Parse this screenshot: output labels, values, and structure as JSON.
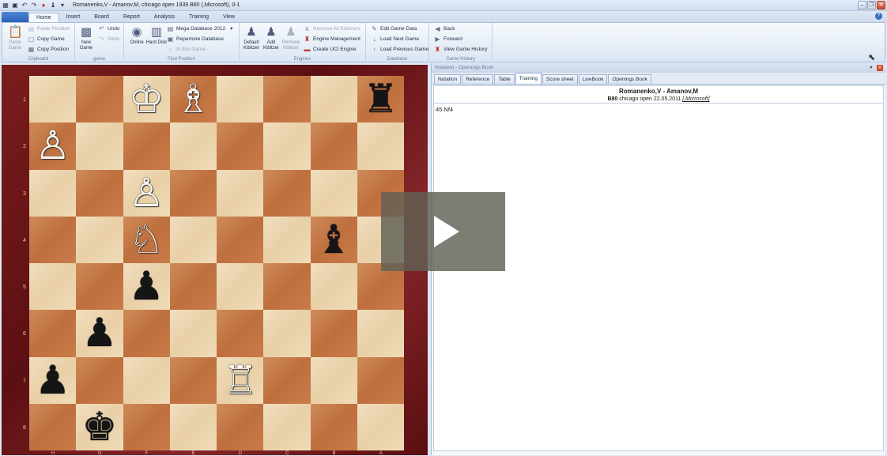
{
  "window": {
    "title": "Romanenko,V - Amanov,M, chicago open 1939  B80  (,Microsoft), 0-1"
  },
  "ribbon_tabs": {
    "file": "",
    "home": "Home",
    "insert": "Insert",
    "board": "Board",
    "report": "Report",
    "analysis": "Analysis",
    "training": "Training",
    "view": "View"
  },
  "clipboard": {
    "paste_game": "Paste Game",
    "paste_position": "Paste Position",
    "copy_game": "Copy Game",
    "copy_position": "Copy Position",
    "label": "Clipboard"
  },
  "game_group": {
    "new_game": "New Game",
    "undo": "Undo",
    "redo": "Redo",
    "label": "game"
  },
  "find_position": {
    "online": "Online",
    "hard_disk": "Hard Disk",
    "database_select": "Mega Database 2012",
    "repertoire": "Repertoire Database",
    "in_this_game": "In this Game",
    "label": "Find Position"
  },
  "engines": {
    "default_kibitzer": "Default Kibitzer",
    "add_kibitzer": "Add Kibitzer",
    "remove_kibitzer": "Remove Kibitzer",
    "remove_all": "Remove All Kibitzers",
    "engine_management": "Engine Management",
    "create_uci": "Create UCI Engine",
    "label": "Engines"
  },
  "database": {
    "edit_game_data": "Edit Game Data",
    "load_next": "Load Next Game",
    "load_previous": "Load Previous Game",
    "label": "Database"
  },
  "history": {
    "back": "Back",
    "forward": "Forward",
    "view_history": "View Game History",
    "label": "Game History"
  },
  "board": {
    "ranks": [
      "1",
      "2",
      "3",
      "4",
      "5",
      "6",
      "7",
      "8"
    ],
    "files": [
      "H",
      "G",
      "F",
      "E",
      "D",
      "C",
      "B",
      "A"
    ],
    "pieces": [
      {
        "square": "f1",
        "glyph": "♔",
        "color": "white",
        "name": "white-king"
      },
      {
        "square": "e1",
        "glyph": "♗",
        "color": "white",
        "name": "white-bishop"
      },
      {
        "square": "a1",
        "glyph": "♜",
        "color": "black",
        "name": "black-rook"
      },
      {
        "square": "h2",
        "glyph": "♙",
        "color": "white",
        "name": "white-pawn"
      },
      {
        "square": "f3",
        "glyph": "♙",
        "color": "white",
        "name": "white-pawn"
      },
      {
        "square": "f4",
        "glyph": "♘",
        "color": "white",
        "name": "white-knight"
      },
      {
        "square": "b4",
        "glyph": "♝",
        "color": "black",
        "name": "black-bishop"
      },
      {
        "square": "f5",
        "glyph": "♟",
        "color": "black",
        "name": "black-pawn"
      },
      {
        "square": "g6",
        "glyph": "♟",
        "color": "black",
        "name": "black-pawn"
      },
      {
        "square": "h7",
        "glyph": "♟",
        "color": "black",
        "name": "black-pawn"
      },
      {
        "square": "d7",
        "glyph": "♖",
        "color": "white",
        "name": "white-rook"
      },
      {
        "square": "g8",
        "glyph": "♚",
        "color": "black",
        "name": "black-king"
      }
    ]
  },
  "notation_panel": {
    "header": "Notation - Openings Book",
    "tabs": [
      "Notation",
      "Reference",
      "Table",
      "Training",
      "Score sheet",
      "LiveBook",
      "Openings Book"
    ],
    "active_tab": "Training",
    "players": "Romanenko,V - Amanov,M",
    "eco": "B80",
    "event": " chicago open 22.05.2011 ",
    "annotator": "[,Microsoft]",
    "moves": "45.Nf4"
  },
  "colors": {
    "board_light": "#eed9b4",
    "board_dark": "#c57846",
    "frame": "#6e1a1c",
    "ribbon_accent": "#2a5fb6"
  }
}
